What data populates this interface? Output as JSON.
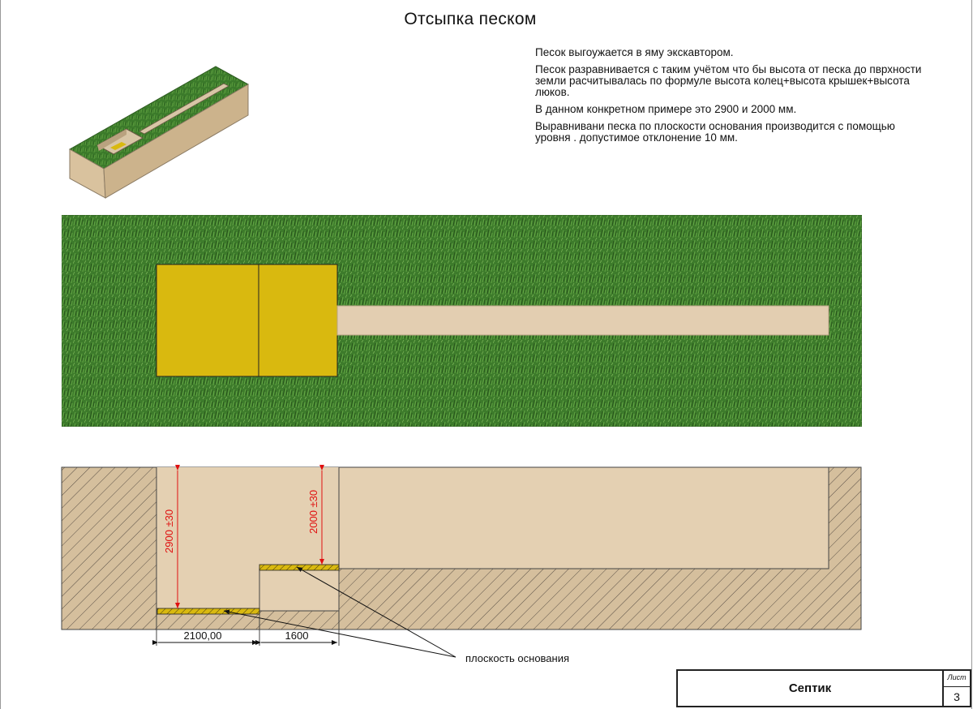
{
  "title": "Отсыпка песком",
  "notes": [
    "Песок выгоужается в яму экскавтором.",
    "Песок разравнивается с таким учётом что бы высота от песка до пврхности земли расчитывалась по формуле высота колец+высота крышек+высота люков.",
    "В данном конкретном примере это 2900 и 2000 мм.",
    "Выравнивани песка по плоскости основания  производится с помощью уровня . допустимое отклонение 10 мм."
  ],
  "section": {
    "dim_height_deep": "2900 ±30",
    "dim_height_shallow": "2000 ±30",
    "dim_width_deep": "2100,00",
    "dim_width_shallow": "1600",
    "leader_label": "плоскость основания"
  },
  "stamp": {
    "name": "Септик",
    "sheet_label": "Лист",
    "sheet_number": "3"
  },
  "colors": {
    "grass": "#3f7d2c",
    "sand": "#e2cdb0",
    "pit_yellow": "#d9b90f",
    "hatch": "#5a5046",
    "dimension_red": "#e01010"
  }
}
